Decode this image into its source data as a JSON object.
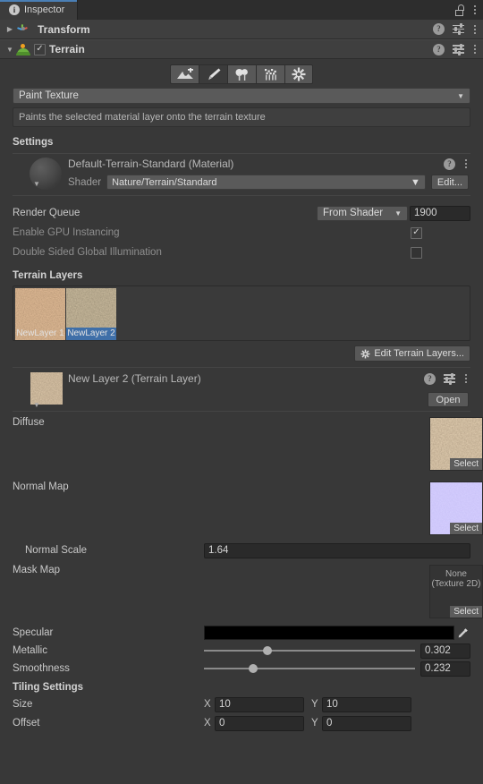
{
  "window": {
    "tab_label": "Inspector",
    "tab_icon": "info-icon",
    "lock_icon": "lock-icon",
    "menu_icon": "kebab-menu-icon"
  },
  "components": [
    {
      "name": "Transform",
      "icon": "axis-gizmo-icon",
      "foldout": "▶",
      "expanded": false,
      "has_checkbox": false
    },
    {
      "name": "Terrain",
      "icon": "terrain-icon",
      "foldout": "▼",
      "expanded": true,
      "has_checkbox": true,
      "checked": true,
      "check_glyph": "✓"
    }
  ],
  "header_icons": {
    "help": "?",
    "preset": "preset-icon",
    "menu": "kebab-menu-icon"
  },
  "toolbar": {
    "tools": [
      {
        "name": "raise-lower-terrain",
        "active": false
      },
      {
        "name": "paint-brush",
        "active": true
      },
      {
        "name": "paint-trees",
        "active": false
      },
      {
        "name": "paint-details",
        "active": false
      },
      {
        "name": "terrain-settings",
        "active": false
      }
    ]
  },
  "tool_selector": {
    "value": "Paint Texture",
    "caret": "▼",
    "description": "Paints the selected material layer onto the terrain texture"
  },
  "settings": {
    "title": "Settings",
    "material": {
      "name": "Default-Terrain-Standard (Material)",
      "shader_label": "Shader",
      "shader_value": "Nature/Terrain/Standard",
      "edit_button": "Edit...",
      "caret": "▼"
    },
    "render_queue": {
      "label": "Render Queue",
      "mode": "From Shader",
      "value": "1900",
      "caret": "▼"
    },
    "gpu_instancing": {
      "label": "Enable GPU Instancing",
      "checked": true,
      "check_glyph": "✓"
    },
    "double_sided_gi": {
      "label": "Double Sided Global Illumination",
      "checked": false
    }
  },
  "terrain_layers": {
    "title": "Terrain Layers",
    "layers": [
      {
        "name": "NewLayer 1",
        "selected": false,
        "color": "#c08a5e"
      },
      {
        "name": "NewLayer 2",
        "selected": true,
        "color": "#8e7c60"
      }
    ],
    "edit_button": "Edit Terrain Layers...",
    "edit_button_icon": "gear-icon"
  },
  "layer_inspector": {
    "title": "New Layer 2 (Terrain Layer)",
    "open_button": "Open",
    "foldout": "▼",
    "diffuse": {
      "label": "Diffuse",
      "select_label": "Select"
    },
    "normal_map": {
      "label": "Normal Map",
      "select_label": "Select"
    },
    "normal_scale": {
      "label": "Normal Scale",
      "value": "1.64"
    },
    "mask_map": {
      "label": "Mask Map",
      "none_line1": "None",
      "none_line2": "(Texture 2D)",
      "select_label": "Select"
    },
    "specular": {
      "label": "Specular",
      "color": "#000000",
      "eyedropper_icon": "eyedropper-icon"
    },
    "metallic": {
      "label": "Metallic",
      "value": "0.302",
      "percent": 30.2
    },
    "smoothness": {
      "label": "Smoothness",
      "value": "0.232",
      "percent": 23.2
    },
    "tiling": {
      "title": "Tiling Settings",
      "size": {
        "label": "Size",
        "x_label": "X",
        "x": "10",
        "y_label": "Y",
        "y": "10"
      },
      "offset": {
        "label": "Offset",
        "x_label": "X",
        "x": "0",
        "y_label": "Y",
        "y": "0"
      }
    }
  }
}
